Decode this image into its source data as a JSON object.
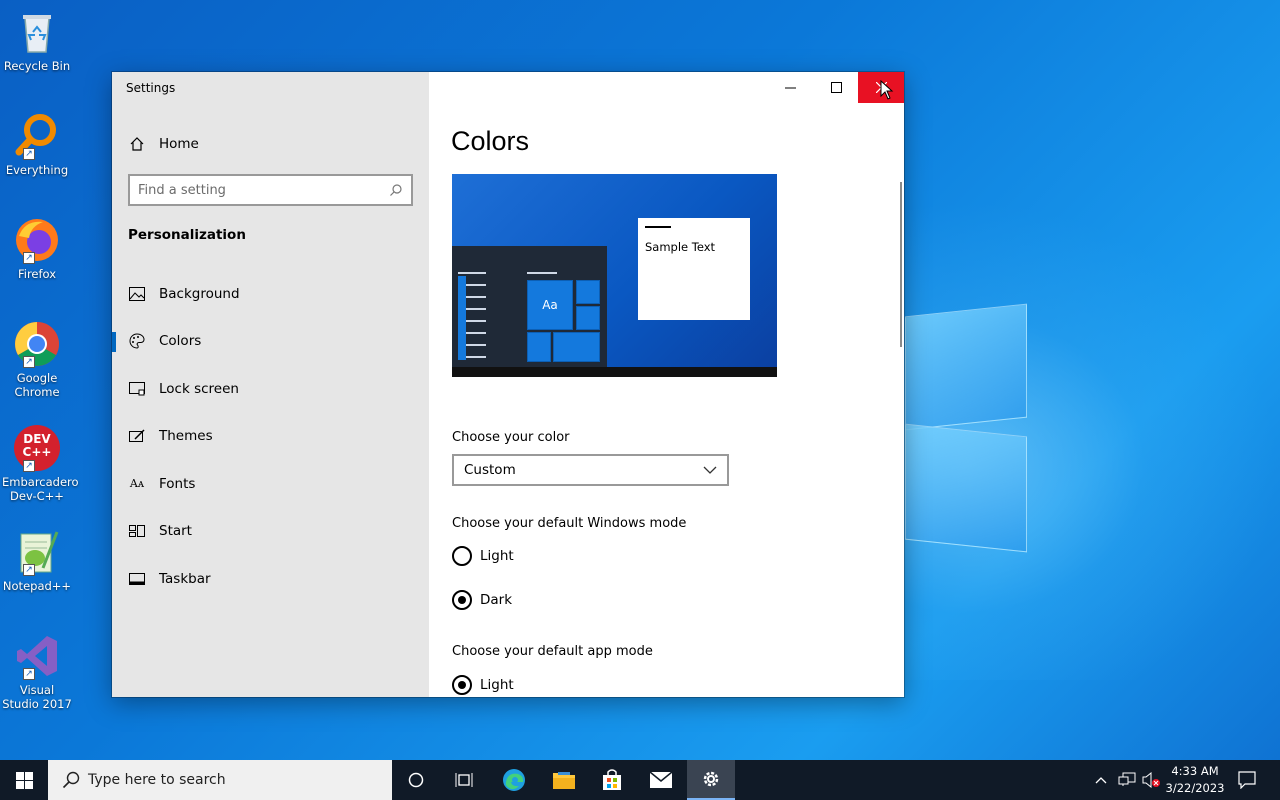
{
  "desktop": {
    "icons": [
      {
        "label": "Recycle Bin",
        "icon": "recycle-bin-icon"
      },
      {
        "label": "Everything",
        "icon": "everything-icon"
      },
      {
        "label": "Firefox",
        "icon": "firefox-icon"
      },
      {
        "label": "Google Chrome",
        "icon": "chrome-icon"
      },
      {
        "label": "Embarcadero Dev-C++",
        "icon": "devcpp-icon",
        "logo_text": "DEV C++"
      },
      {
        "label": "Notepad++",
        "icon": "notepadpp-icon"
      },
      {
        "label": "Visual Studio 2017",
        "icon": "visual-studio-icon"
      }
    ]
  },
  "window": {
    "title": "Settings",
    "caption": {
      "minimize": "—",
      "maximize": "☐",
      "close": "✕"
    }
  },
  "sidebar": {
    "home_label": "Home",
    "search_placeholder": "Find a setting",
    "section_title": "Personalization",
    "items": [
      {
        "label": "Background",
        "icon": "picture-icon"
      },
      {
        "label": "Colors",
        "icon": "palette-icon",
        "active": true
      },
      {
        "label": "Lock screen",
        "icon": "lock-screen-icon"
      },
      {
        "label": "Themes",
        "icon": "brush-icon"
      },
      {
        "label": "Fonts",
        "icon": "font-icon"
      },
      {
        "label": "Start",
        "icon": "start-tiles-icon"
      },
      {
        "label": "Taskbar",
        "icon": "taskbar-icon"
      }
    ]
  },
  "main": {
    "title": "Colors",
    "preview": {
      "sample_text": "Sample Text",
      "tile_text": "Aa"
    },
    "choose_color_label": "Choose your color",
    "choose_color_value": "Custom",
    "windows_mode_label": "Choose your default Windows mode",
    "windows_mode_options": [
      {
        "label": "Light",
        "selected": false
      },
      {
        "label": "Dark",
        "selected": true
      }
    ],
    "app_mode_label": "Choose your default app mode",
    "app_mode_options": [
      {
        "label": "Light",
        "selected": true
      }
    ]
  },
  "taskbar": {
    "search_placeholder": "Type here to search",
    "time": "4:33 AM",
    "date": "3/22/2023"
  },
  "colors": {
    "accent": "#0067c0",
    "close_red": "#e81123",
    "taskbar": "#101a27"
  }
}
